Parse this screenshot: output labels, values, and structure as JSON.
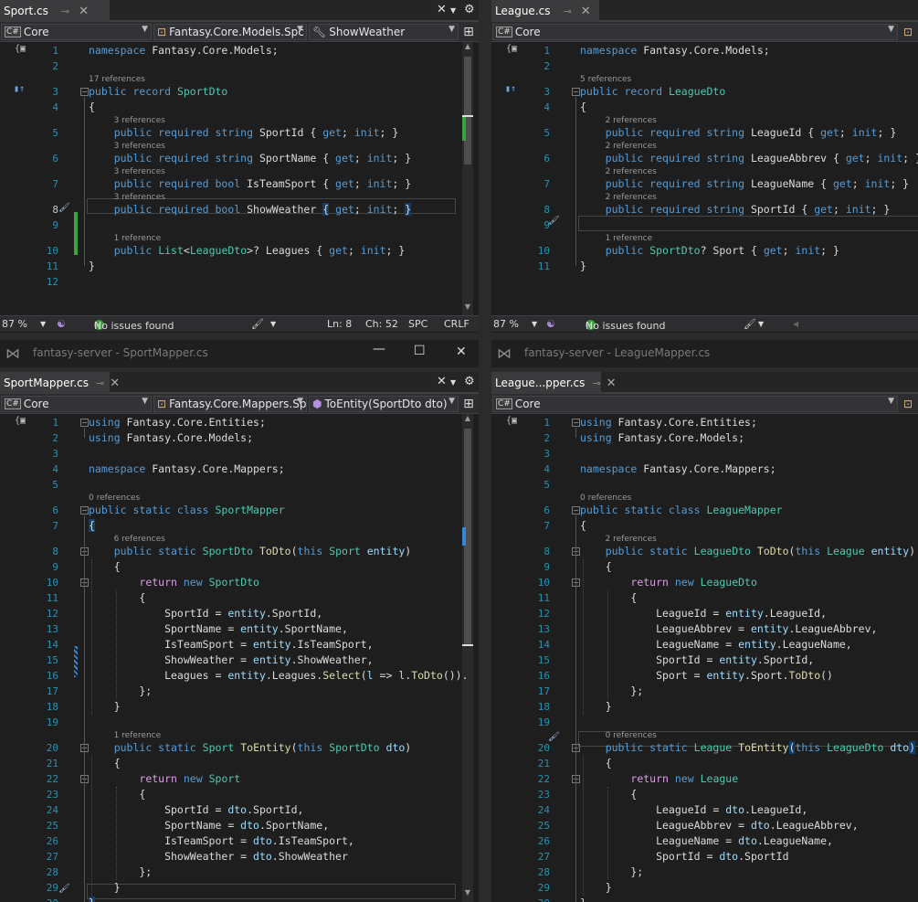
{
  "panes": {
    "tl": {
      "tab": "Sport.cs",
      "project": "Core",
      "type_combo": "Fantasy.Core.Models.Spc",
      "member_combo": "ShowWeather",
      "zoom": "87 %",
      "issues": "No issues found",
      "ln": "Ln: 8",
      "ch": "Ch: 52",
      "spc": "SPC",
      "crlf": "CRLF"
    },
    "tr": {
      "tab": "League.cs",
      "project": "Core",
      "zoom": "87 %",
      "issues": "No issues found"
    },
    "bl": {
      "window_title": "fantasy-server - SportMapper.cs",
      "tab": "SportMapper.cs",
      "project": "Core",
      "type_combo": "Fantasy.Core.Mappers.Sp",
      "member_combo": "ToEntity(SportDto dto)"
    },
    "br": {
      "window_title": "fantasy-server - LeagueMapper.cs",
      "tab": "League...pper.cs",
      "project": "Core"
    }
  },
  "icons": {
    "close": "close-icon",
    "pin": "pin-icon",
    "gear": "gear-icon",
    "split": "split-editor-icon",
    "csharp": "csharp-file-icon",
    "wrench": "wrench-icon",
    "brush": "brush-icon",
    "check": "check-circle-icon",
    "copilot": "copilot-icon",
    "vs_logo": "visual-studio-logo-icon",
    "minimize": "minimize-icon",
    "maximize": "maximize-icon"
  },
  "code": {
    "tl": [
      {
        "n": "1",
        "html": "<span class='kw'>namespace</span> Fantasy.Core.Models;"
      },
      {
        "n": "2",
        "html": ""
      },
      {
        "n": "3",
        "ref": "17 references",
        "html": "<span class='kw'>public record</span> <span class='ty'>SportDto</span>"
      },
      {
        "n": "4",
        "html": "{"
      },
      {
        "n": "5",
        "ref": "3 references",
        "html": "    <span class='kw'>public required string</span> SportId { <span class='kw'>get</span>; <span class='kw'>init</span>; }"
      },
      {
        "n": "6",
        "ref": "3 references",
        "html": "    <span class='kw'>public required string</span> SportName { <span class='kw'>get</span>; <span class='kw'>init</span>; }"
      },
      {
        "n": "7",
        "ref": "3 references",
        "html": "    <span class='kw'>public required bool</span> IsTeamSport { <span class='kw'>get</span>; <span class='kw'>init</span>; }"
      },
      {
        "n": "8",
        "ref": "3 references",
        "html": "    <span class='kw'>public required bool</span> ShowWeather <span class='brace-hl'>{</span> <span class='kw'>get</span>; <span class='kw'>init</span>; <span class='brace-hl'>}</span>"
      },
      {
        "n": "9",
        "html": ""
      },
      {
        "n": "10",
        "ref": "1 reference",
        "html": "    <span class='kw'>public</span> <span class='ty'>List</span>&lt;<span class='ty'>LeagueDto</span>&gt;? Leagues { <span class='kw'>get</span>; <span class='kw'>init</span>; }"
      },
      {
        "n": "11",
        "html": "}"
      },
      {
        "n": "12",
        "html": ""
      }
    ],
    "tr": [
      {
        "n": "1",
        "html": "<span class='kw'>namespace</span> Fantasy.Core.Models;"
      },
      {
        "n": "2",
        "html": ""
      },
      {
        "n": "3",
        "ref": "5 references",
        "html": "<span class='kw'>public record</span> <span class='ty'>LeagueDto</span>"
      },
      {
        "n": "4",
        "html": "{"
      },
      {
        "n": "5",
        "ref": "2 references",
        "html": "    <span class='kw'>public required string</span> LeagueId { <span class='kw'>get</span>; <span class='kw'>init</span>; }"
      },
      {
        "n": "6",
        "ref": "2 references",
        "html": "    <span class='kw'>public required string</span> LeagueAbbrev { <span class='kw'>get</span>; <span class='kw'>init</span>; }"
      },
      {
        "n": "7",
        "ref": "2 references",
        "html": "    <span class='kw'>public required string</span> LeagueName { <span class='kw'>get</span>; <span class='kw'>init</span>; }"
      },
      {
        "n": "8",
        "ref": "2 references",
        "html": "    <span class='kw'>public required string</span> SportId { <span class='kw'>get</span>; <span class='kw'>init</span>; }"
      },
      {
        "n": "9",
        "html": ""
      },
      {
        "n": "10",
        "ref": "1 reference",
        "html": "    <span class='kw'>public</span> <span class='ty'>SportDto</span>? Sport { <span class='kw'>get</span>; <span class='kw'>init</span>; }"
      },
      {
        "n": "11",
        "html": "}"
      }
    ],
    "bl": [
      {
        "n": "1",
        "html": "<span class='kw'>using</span> Fantasy.Core.Entities;"
      },
      {
        "n": "2",
        "html": "<span class='kw'>using</span> Fantasy.Core.Models;"
      },
      {
        "n": "3",
        "html": ""
      },
      {
        "n": "4",
        "html": "<span class='kw'>namespace</span> Fantasy.Core.Mappers;"
      },
      {
        "n": "5",
        "html": ""
      },
      {
        "n": "6",
        "ref": "0 references",
        "html": "<span class='kw'>public static class</span> <span class='ty'>SportMapper</span>"
      },
      {
        "n": "7",
        "html": "<span class='brace-hl'>{</span>"
      },
      {
        "n": "8",
        "ref": "6 references",
        "html": "    <span class='kw'>public static</span> <span class='ty'>SportDto</span> <span class='me'>ToDto</span>(<span class='kw'>this</span> <span class='ty'>Sport</span> <span class='pr'>entity</span>)"
      },
      {
        "n": "9",
        "html": "    {"
      },
      {
        "n": "10",
        "html": "        <span class='ctl'>return</span> <span class='kw'>new</span> <span class='ty'>SportDto</span>"
      },
      {
        "n": "11",
        "html": "        {"
      },
      {
        "n": "12",
        "html": "            SportId = <span class='pr'>entity</span>.SportId,"
      },
      {
        "n": "13",
        "html": "            SportName = <span class='pr'>entity</span>.SportName,"
      },
      {
        "n": "14",
        "html": "            IsTeamSport = <span class='pr'>entity</span>.IsTeamSport,"
      },
      {
        "n": "15",
        "html": "            ShowWeather = <span class='pr'>entity</span>.ShowWeather,"
      },
      {
        "n": "16",
        "html": "            Leagues = <span class='pr'>entity</span>.Leagues.<span class='me'>Select</span>(<span class='pr'>l</span> =&gt; <span class='pr'>l</span>.<span class='me'>ToDto</span>())."
      },
      {
        "n": "17",
        "html": "        };"
      },
      {
        "n": "18",
        "html": "    }"
      },
      {
        "n": "19",
        "html": ""
      },
      {
        "n": "20",
        "ref": "1 reference",
        "html": "    <span class='kw'>public static</span> <span class='ty'>Sport</span> <span class='me'>ToEntity</span>(<span class='kw'>this</span> <span class='ty'>SportDto</span> <span class='pr'>dto</span>)"
      },
      {
        "n": "21",
        "html": "    {"
      },
      {
        "n": "22",
        "html": "        <span class='ctl'>return</span> <span class='kw'>new</span> <span class='ty'>Sport</span>"
      },
      {
        "n": "23",
        "html": "        {"
      },
      {
        "n": "24",
        "html": "            SportId = <span class='pr'>dto</span>.SportId,"
      },
      {
        "n": "25",
        "html": "            SportName = <span class='pr'>dto</span>.SportName,"
      },
      {
        "n": "26",
        "html": "            IsTeamSport = <span class='pr'>dto</span>.IsTeamSport,"
      },
      {
        "n": "27",
        "html": "            ShowWeather = <span class='pr'>dto</span>.ShowWeather"
      },
      {
        "n": "28",
        "html": "        };"
      },
      {
        "n": "29",
        "html": "    }"
      },
      {
        "n": "30",
        "html": "<span class='brace-hl'>}</span>"
      }
    ],
    "br": [
      {
        "n": "1",
        "html": "<span class='kw'>using</span> Fantasy.Core.Entities;"
      },
      {
        "n": "2",
        "html": "<span class='kw'>using</span> Fantasy.Core.Models;"
      },
      {
        "n": "3",
        "html": ""
      },
      {
        "n": "4",
        "html": "<span class='kw'>namespace</span> Fantasy.Core.Mappers;"
      },
      {
        "n": "5",
        "html": ""
      },
      {
        "n": "6",
        "ref": "0 references",
        "html": "<span class='kw'>public static class</span> <span class='ty'>LeagueMapper</span>"
      },
      {
        "n": "7",
        "html": "{"
      },
      {
        "n": "8",
        "ref": "2 references",
        "html": "    <span class='kw'>public static</span> <span class='ty'>LeagueDto</span> <span class='me'>ToDto</span>(<span class='kw'>this</span> <span class='ty'>League</span> <span class='pr'>entity</span>)"
      },
      {
        "n": "9",
        "html": "    {"
      },
      {
        "n": "10",
        "html": "        <span class='ctl'>return</span> <span class='kw'>new</span> <span class='ty'>LeagueDto</span>"
      },
      {
        "n": "11",
        "html": "        {"
      },
      {
        "n": "12",
        "html": "            LeagueId = <span class='pr'>entity</span>.LeagueId,"
      },
      {
        "n": "13",
        "html": "            LeagueAbbrev = <span class='pr'>entity</span>.LeagueAbbrev,"
      },
      {
        "n": "14",
        "html": "            LeagueName = <span class='pr'>entity</span>.LeagueName,"
      },
      {
        "n": "15",
        "html": "            SportId = <span class='pr'>entity</span>.SportId,"
      },
      {
        "n": "16",
        "html": "            Sport = <span class='pr'>entity</span>.Sport.<span class='me'>ToDto</span>()"
      },
      {
        "n": "17",
        "html": "        };"
      },
      {
        "n": "18",
        "html": "    }"
      },
      {
        "n": "19",
        "html": ""
      },
      {
        "n": "20",
        "ref": "0 references",
        "html": "    <span class='kw'>public static</span> <span class='ty'>League</span> <span class='me'>ToEntity</span><span class='brace-hl'>(</span><span class='kw'>this</span> <span class='ty'>LeagueDto</span> <span class='pr'>dto</span><span class='brace-hl'>)</span>"
      },
      {
        "n": "21",
        "html": "    {"
      },
      {
        "n": "22",
        "html": "        <span class='ctl'>return</span> <span class='kw'>new</span> <span class='ty'>League</span>"
      },
      {
        "n": "23",
        "html": "        {"
      },
      {
        "n": "24",
        "html": "            LeagueId = <span class='pr'>dto</span>.LeagueId,"
      },
      {
        "n": "25",
        "html": "            LeagueAbbrev = <span class='pr'>dto</span>.LeagueAbbrev,"
      },
      {
        "n": "26",
        "html": "            LeagueName = <span class='pr'>dto</span>.LeagueName,"
      },
      {
        "n": "27",
        "html": "            SportId = <span class='pr'>dto</span>.SportId"
      },
      {
        "n": "28",
        "html": "        };"
      },
      {
        "n": "29",
        "html": "    }"
      },
      {
        "n": "30",
        "html": "}"
      }
    ]
  }
}
